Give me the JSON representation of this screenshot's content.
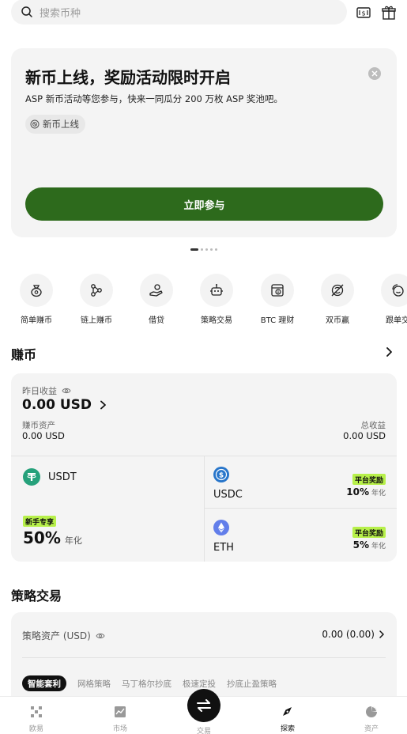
{
  "search": {
    "placeholder": "搜索币种"
  },
  "banner": {
    "title": "新币上线，奖励活动限时开启",
    "description": "ASP 新币活动等您参与，快来一同瓜分 200 万枚 ASP 奖池吧。",
    "tag": "新币上线",
    "cta": "立即参与",
    "page_count": 5,
    "active_page": 1
  },
  "quick_actions": [
    {
      "label": "简单赚币",
      "icon": "money-bag-icon"
    },
    {
      "label": "链上赚币",
      "icon": "chain-nodes-icon"
    },
    {
      "label": "借贷",
      "icon": "hand-coin-icon"
    },
    {
      "label": "策略交易",
      "icon": "robot-icon"
    },
    {
      "label": "BTC 理财",
      "icon": "btc-safe-icon"
    },
    {
      "label": "双币赢",
      "icon": "dual-coin-icon"
    },
    {
      "label": "跟单交",
      "icon": "copy-trade-icon"
    }
  ],
  "earn": {
    "section_title": "赚币",
    "yesterday_label": "昨日收益",
    "yesterday_value": "0.00 USD",
    "assets_label": "赚币资产",
    "assets_value": "0.00 USD",
    "total_label": "总收益",
    "total_value": "0.00 USD",
    "products": {
      "usdt": {
        "name": "USDT",
        "badge": "新手专享",
        "rate": "50%",
        "unit": "年化"
      },
      "usdc": {
        "name": "USDC",
        "badge": "平台奖励",
        "rate": "10%",
        "unit": "年化"
      },
      "eth": {
        "name": "ETH",
        "badge": "平台奖励",
        "rate": "5%",
        "unit": "年化"
      }
    }
  },
  "strategy": {
    "section_title": "策略交易",
    "assets_label": "策略资产 (USD)",
    "assets_value": "0.00 (0.00)",
    "tabs": [
      "智能套利",
      "网格策略",
      "马丁格尔抄底",
      "极速定投",
      "抄底止盈策略"
    ]
  },
  "nav": {
    "items": [
      "欧易",
      "市场",
      "交易",
      "探索",
      "资产"
    ],
    "active": "探索"
  },
  "colors": {
    "accent_green": "#2d6a1c",
    "badge_green": "#b7f04a",
    "card_bg": "#f4f4f4",
    "usdt": "#26a17b",
    "usdc": "#2775ca",
    "eth": "#627eea"
  }
}
